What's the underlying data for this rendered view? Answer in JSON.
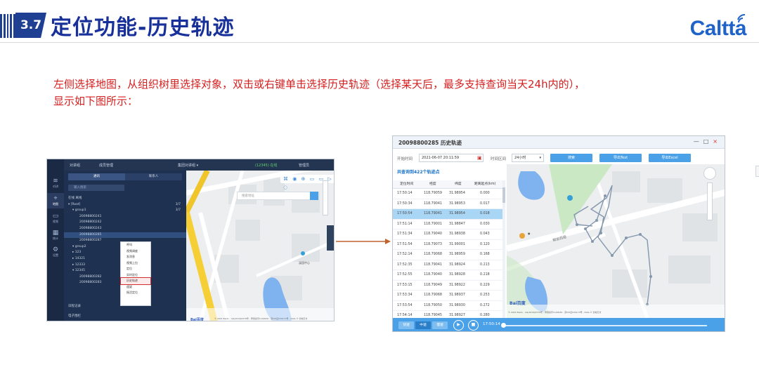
{
  "header": {
    "section_number": "3.7",
    "title": "定位功能-历史轨迹",
    "logo_text": "Caltta",
    "brand_color": "#1f3f93",
    "logo_color": "#1f63c8"
  },
  "description": "左侧选择地图，从组织树里选择对象，双击或右键单击选择历史轨迹（选择某天后，最多支持查询当天24h内的），显示如下图所示：",
  "left_screenshot": {
    "top_bar": [
      "对讲组",
      "成员管理",
      "集团对讲组 ▾",
      "(12345) 在线",
      "管理员"
    ],
    "rail_items": [
      {
        "label": "对讲",
        "icon": "ptt-icon"
      },
      {
        "label": "地图",
        "icon": "map-icon"
      },
      {
        "label": "视频",
        "icon": "video-icon"
      },
      {
        "label": "统计",
        "icon": "grid-icon"
      },
      {
        "label": "设置",
        "icon": "settings-icon"
      }
    ],
    "tabs": [
      "通讯",
      "联系人"
    ],
    "search_placeholder": "输入搜索",
    "tree_rows": [
      {
        "text": "在线  离线",
        "indent": 6,
        "selected": false
      },
      {
        "text": "▾ [Root]",
        "indent": 6,
        "selected": false,
        "count": "3/7"
      },
      {
        "text": "▾ group1",
        "indent": 12,
        "selected": false,
        "count": "3/7"
      },
      {
        "text": "20098800241",
        "indent": 22,
        "selected": false
      },
      {
        "text": "20098800242",
        "indent": 22,
        "selected": false
      },
      {
        "text": "20098800243",
        "indent": 22,
        "selected": false
      },
      {
        "text": "20098800285",
        "indent": 22,
        "selected": true
      },
      {
        "text": "20098800287",
        "indent": 22,
        "selected": false
      },
      {
        "text": "▾ group2",
        "indent": 12,
        "selected": false
      },
      {
        "text": "▸ 123",
        "indent": 12,
        "selected": false
      },
      {
        "text": "▸ 14321",
        "indent": 12,
        "selected": false
      },
      {
        "text": "▸ 12333",
        "indent": 12,
        "selected": false
      },
      {
        "text": "▾ 12345",
        "indent": 12,
        "selected": false
      },
      {
        "text": "20098800282",
        "indent": 22,
        "selected": false
      },
      {
        "text": "20098800283",
        "indent": 22,
        "selected": false
      }
    ],
    "bottom_rows": [
      "日程记录",
      "电子围栏"
    ],
    "context_menu": [
      {
        "label": "呼叫",
        "highlight": false
      },
      {
        "label": "视频调度",
        "highlight": false
      },
      {
        "label": "发消息",
        "highlight": false
      },
      {
        "label": "视频上拉",
        "highlight": false
      },
      {
        "label": "定位",
        "highlight": false
      },
      {
        "label": "实时定位",
        "highlight": false
      },
      {
        "label": "历史轨迹",
        "highlight": true
      },
      {
        "label": "遥毙",
        "highlight": false
      },
      {
        "label": "摇活定位",
        "highlight": false
      }
    ],
    "map_search_placeholder": "搜索地址",
    "map_label": "溪园中心",
    "map_footer": "© 2021 Baidu - GS(2019)6379号 - 甲测资字1100930 - 京ICP证030173号 - Data © 长地万方"
  },
  "right_screenshot": {
    "window_title": "20098800285  历史轨迹",
    "window_buttons": [
      "—",
      "□",
      "×"
    ],
    "start_label": "开始时间",
    "start_value": "2021-06-07 20:11:59",
    "range_label": "时间区间",
    "range_value": "24小时",
    "buttons": [
      "搜索",
      "导出Text",
      "导出Excel"
    ],
    "count_text": "共查询到422个轨迹点",
    "columns": [
      "定位时间",
      "经度",
      "纬度",
      "距离起点(km)"
    ],
    "rows": [
      {
        "time": "17:50:14",
        "lng": "118.79059",
        "lat": "31.98954",
        "dist": "0.000",
        "selected": false
      },
      {
        "time": "17:50:34",
        "lng": "118.79041",
        "lat": "31.98953",
        "dist": "0.017",
        "selected": false
      },
      {
        "time": "17:50:54",
        "lng": "118.79041",
        "lat": "31.98954",
        "dist": "0.018",
        "selected": true
      },
      {
        "time": "17:51:14",
        "lng": "118.79001",
        "lat": "31.98847",
        "dist": "0.030",
        "selected": false
      },
      {
        "time": "17:51:34",
        "lng": "118.79040",
        "lat": "31.98938",
        "dist": "0.043",
        "selected": false
      },
      {
        "time": "17:51:54",
        "lng": "118.79073",
        "lat": "31.99001",
        "dist": "0.120",
        "selected": false
      },
      {
        "time": "17:52:14",
        "lng": "118.79068",
        "lat": "31.98959",
        "dist": "0.168",
        "selected": false
      },
      {
        "time": "17:52:35",
        "lng": "118.79041",
        "lat": "31.98924",
        "dist": "0.213",
        "selected": false
      },
      {
        "time": "17:52:55",
        "lng": "118.79040",
        "lat": "31.98928",
        "dist": "0.218",
        "selected": false
      },
      {
        "time": "17:53:15",
        "lng": "118.79049",
        "lat": "31.98922",
        "dist": "0.229",
        "selected": false
      },
      {
        "time": "17:53:34",
        "lng": "118.79068",
        "lat": "31.98937",
        "dist": "0.253",
        "selected": false
      },
      {
        "time": "17:53:54",
        "lng": "118.79050",
        "lat": "31.98930",
        "dist": "0.272",
        "selected": false
      },
      {
        "time": "17:54:14",
        "lng": "118.79045",
        "lat": "31.98927",
        "dist": "0.280",
        "selected": false
      }
    ],
    "map_label": "解放西路",
    "map_footer": "© 2021 Baidu - GS(2019)6379号 - 甲测资字1100930 - 京ICP证030173号 - Data © 长地万方",
    "player": {
      "speeds": [
        "快速",
        "中速",
        "慢速"
      ],
      "active_speed": 1,
      "time": "17:50:14",
      "progress": 0.0
    },
    "accent_color": "#4aa1e8"
  }
}
